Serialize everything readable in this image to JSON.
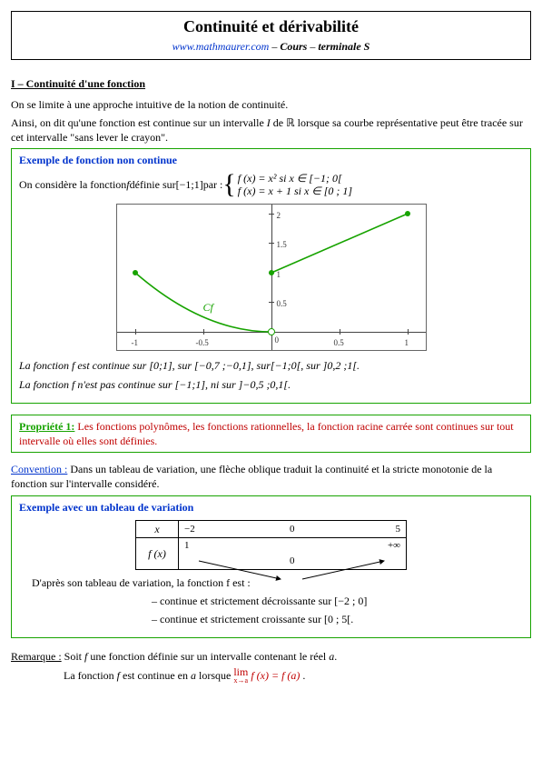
{
  "header": {
    "title": "Continuité et dérivabilité",
    "link": "www.mathmaurer.com",
    "sep": " – ",
    "cours": "Cours",
    "level": "terminale S"
  },
  "section1": {
    "title": "I – Continuité d'une fonction",
    "p1": "On se limite à une approche intuitive de la notion de continuité.",
    "p2a": "Ainsi, on dit qu'une fonction est continue sur un intervalle ",
    "p2b": "I",
    "p2c": " de ",
    "p2d": "ℝ",
    "p2e": " lorsque sa courbe représentative peut être tracée sur cet intervalle \"sans lever le crayon\"."
  },
  "example1": {
    "title": "Exemple de fonction non continue",
    "introA": "On considère la fonction ",
    "introB": "f",
    "introC": " définie sur ",
    "introD": "[−1;1]",
    "introE": "  par :  ",
    "line1a": "f (x) = x²  si  x ∈ [−1; 0[",
    "line2a": "f (x) = x + 1  si  x ∈ [0 ; 1]",
    "cf": "Cf",
    "cont1": "La fonction f  est continue sur [0;1], sur [−0,7 ;−0,1], sur[−1;0[, sur ]0,2 ;1[.",
    "cont2": "La fonction f n'est pas continue sur [−1;1], ni sur ]−0,5 ;0,1[."
  },
  "prop1": {
    "label": "Propriété 1:",
    "text": " Les fonctions polynômes, les fonctions rationnelles, la fonction racine carrée sont continues sur tout intervalle où elles sont définies."
  },
  "convention": {
    "label": "Convention :",
    "text": " Dans un tableau de variation, une flèche oblique traduit la continuité et la stricte monotonie de la fonction sur l'intervalle considéré."
  },
  "example2": {
    "title": "Exemple avec un tableau de variation",
    "xlabel": "x",
    "flabel": "f (x)",
    "xvals": {
      "a": "−2",
      "b": "0",
      "c": "5"
    },
    "fvals": {
      "a": "1",
      "b": "0",
      "c": "+∞"
    },
    "concl_intro": "D'après son tableau de variation, la fonction f  est :",
    "concl1": "– continue et strictement décroissante sur [−2 ; 0]",
    "concl2": "– continue et strictement croissante sur [0 ; 5[."
  },
  "remark": {
    "label": "Remarque :",
    "line1a": " Soit ",
    "line1b": "f",
    "line1c": " une fonction définie sur un intervalle contenant le réel ",
    "line1d": "a",
    "line1e": ".",
    "line2a": "La fonction ",
    "line2b": "f",
    "line2c": " est continue en ",
    "line2d": "a",
    "line2e": " lorsque ",
    "lim_top": "lim",
    "lim_sub": "x→a",
    "lim_rhs": " f (x) = f (a)",
    "line2f": "."
  },
  "chart_data": {
    "type": "line",
    "title": "",
    "xlabel": "",
    "ylabel": "",
    "xlim": [
      -1.1,
      1.1
    ],
    "ylim": [
      -0.2,
      2.1
    ],
    "xticks": [
      -1,
      -0.5,
      0,
      0.5,
      1
    ],
    "yticks": [
      0,
      0.5,
      1,
      1.5,
      2
    ],
    "series": [
      {
        "name": "f(x)=x² on [-1,0[",
        "x": [
          -1,
          -0.8,
          -0.6,
          -0.4,
          -0.2,
          0
        ],
        "y": [
          1,
          0.64,
          0.36,
          0.16,
          0.04,
          0
        ],
        "open_end": "right"
      },
      {
        "name": "f(x)=x+1 on [0,1]",
        "x": [
          0,
          1
        ],
        "y": [
          1,
          2
        ]
      }
    ],
    "annotations": [
      {
        "text": "Cf",
        "x": -0.55,
        "y": 0.45
      }
    ]
  }
}
